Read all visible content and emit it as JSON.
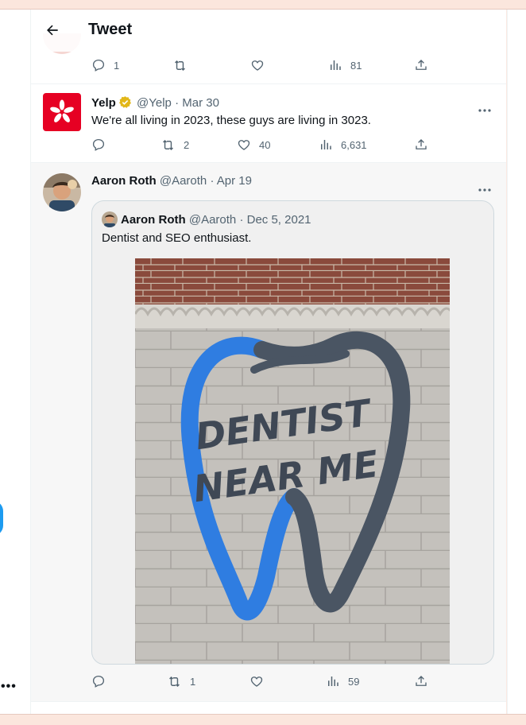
{
  "header": {
    "title": "Tweet"
  },
  "top_tweet": {
    "actions": {
      "replies": "1",
      "retweets": "",
      "likes": "",
      "views": "81"
    }
  },
  "yelp_tweet": {
    "name": "Yelp",
    "handle": "@Yelp",
    "separator": "·",
    "date": "Mar 30",
    "text": "We're all living in 2023, these guys are living in 3023.",
    "actions": {
      "replies": "",
      "retweets": "2",
      "likes": "40",
      "views": "6,631"
    }
  },
  "aaron_tweet": {
    "name": "Aaron Roth",
    "handle": "@Aaroth",
    "separator": "·",
    "date": "Apr 19",
    "quote": {
      "name": "Aaron Roth",
      "handle": "@Aaroth",
      "separator": "·",
      "date": "Dec 5, 2021",
      "text": "Dentist and SEO enthusiast.",
      "image": {
        "sign_line1": "DENTIST",
        "sign_line2": "NEAR ME"
      }
    },
    "actions": {
      "replies": "",
      "retweets": "1",
      "likes": "",
      "views": "59"
    }
  },
  "left_nav": {
    "more_label": "•••"
  },
  "colors": {
    "accent": "#1d9bf0",
    "muted_text": "#536471",
    "yelp_red": "#e60023",
    "verified_gold": "#e2b719"
  }
}
